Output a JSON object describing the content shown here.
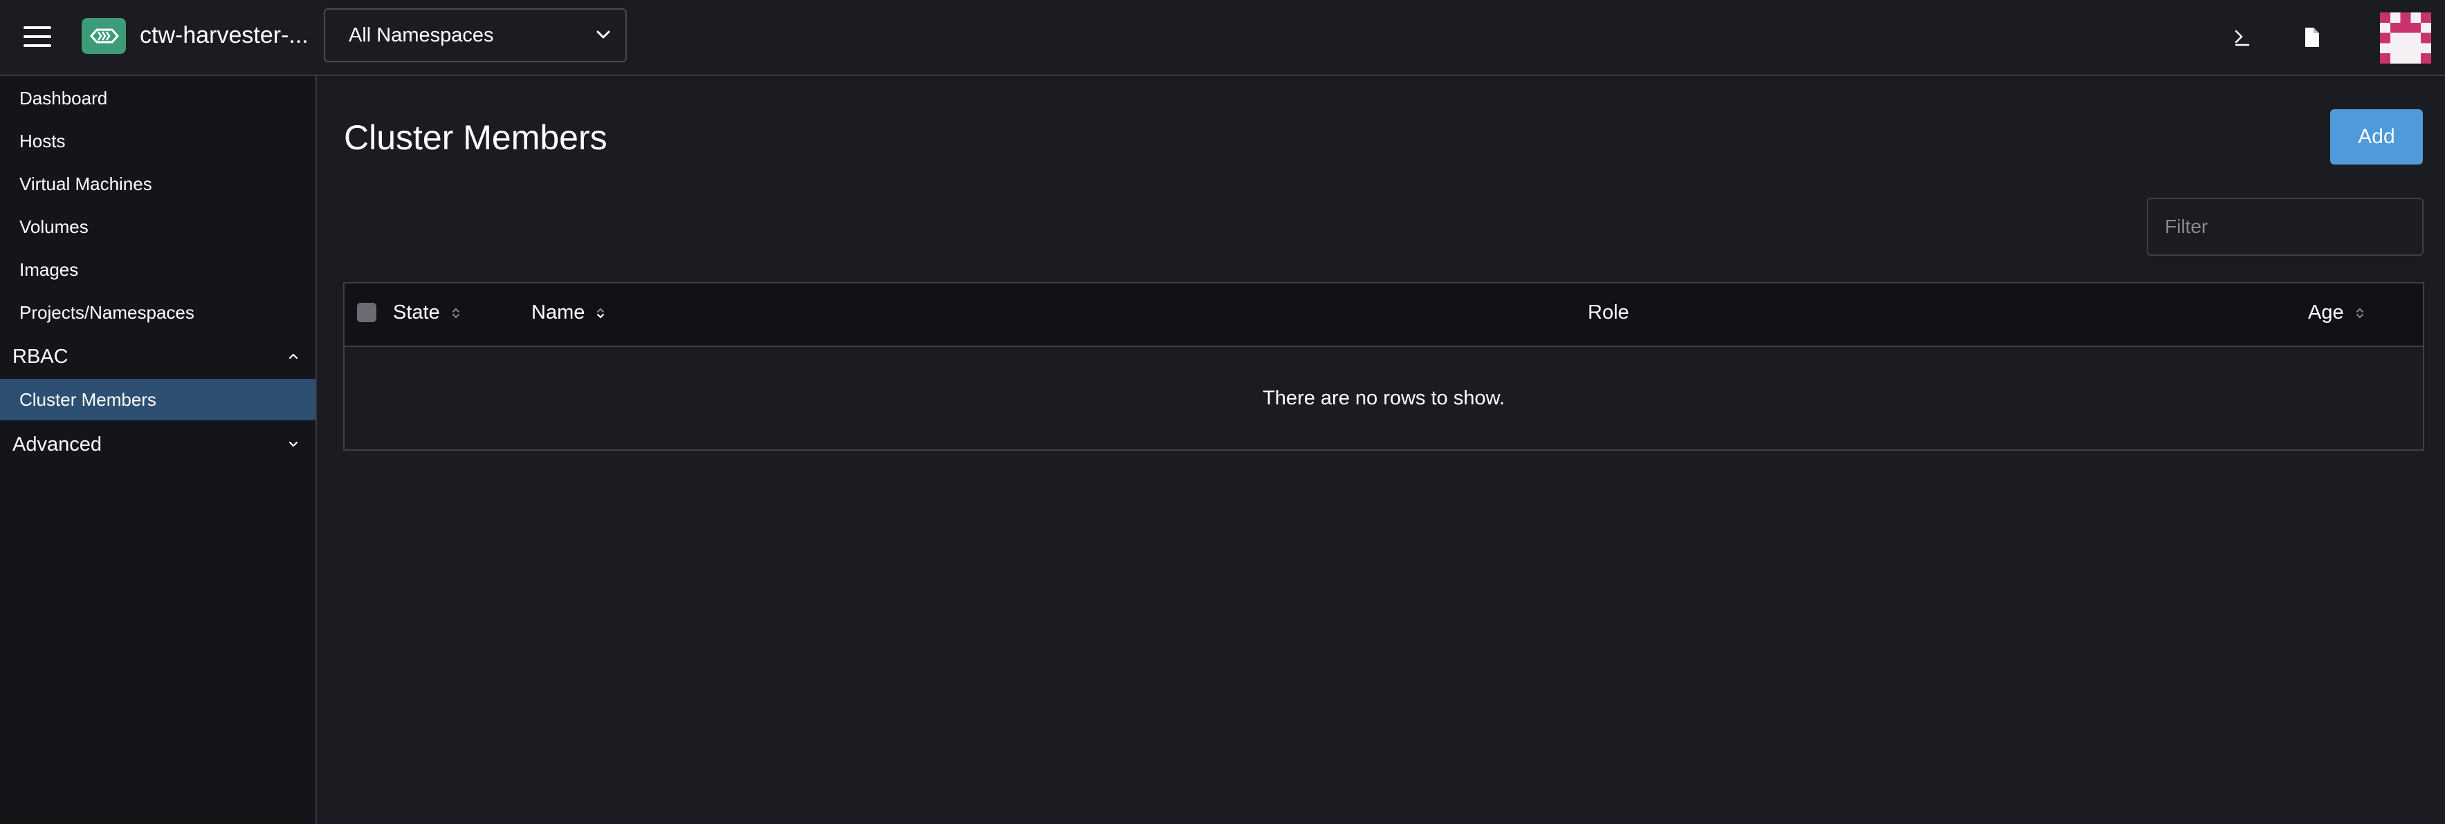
{
  "header": {
    "cluster_name": "ctw-harvester-...",
    "namespace_select": "All Namespaces",
    "icons": [
      "menu-icon",
      "harvester-logo",
      "chevron-down-icon",
      "terminal-icon",
      "file-icon",
      "user-avatar"
    ]
  },
  "sidebar": {
    "items": [
      {
        "label": "Dashboard"
      },
      {
        "label": "Hosts"
      },
      {
        "label": "Virtual Machines"
      },
      {
        "label": "Volumes"
      },
      {
        "label": "Images"
      },
      {
        "label": "Projects/Namespaces"
      }
    ],
    "groups": [
      {
        "label": "RBAC",
        "expanded": true,
        "items": [
          {
            "label": "Cluster Members",
            "active": true
          }
        ]
      },
      {
        "label": "Advanced",
        "expanded": false
      }
    ]
  },
  "main": {
    "title": "Cluster Members",
    "add_label": "Add",
    "filter_placeholder": "Filter",
    "table": {
      "columns": [
        "State",
        "Name",
        "Role",
        "Age"
      ],
      "empty_text": "There are no rows to show."
    }
  },
  "colors": {
    "background": "#1b1c21",
    "sidebar": "#141519",
    "active_nav": "#2d4f72",
    "primary_button": "#4f9ad8",
    "logo": "#3d9b78",
    "avatar_accent": "#c7336d"
  }
}
